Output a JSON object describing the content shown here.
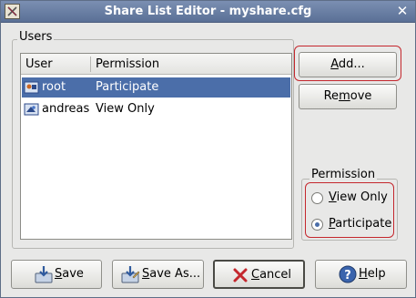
{
  "window": {
    "title": "Share List Editor - myshare.cfg",
    "close_glyph": "✕"
  },
  "users_group": {
    "label": "Users",
    "columns": [
      "User",
      "Permission"
    ],
    "rows": [
      {
        "user": "root",
        "permission": "Participate",
        "selected": true,
        "icon": "user-icon"
      },
      {
        "user": "andreas",
        "permission": "View Only",
        "selected": false,
        "icon": "user-icon"
      }
    ]
  },
  "side_buttons": {
    "add_label": "Add...",
    "add_mnemonic": "A",
    "add_rest": "dd...",
    "remove_label": "Remove",
    "remove_pre": "Re",
    "remove_mnemonic": "m",
    "remove_rest": "ove"
  },
  "permission_group": {
    "label": "Permission",
    "options": [
      {
        "label": "View Only",
        "mnemonic": "V",
        "rest": "iew Only",
        "checked": false
      },
      {
        "label": "Participate",
        "mnemonic": "P",
        "rest": "articipate",
        "checked": true
      }
    ]
  },
  "bottom_buttons": [
    {
      "label": "Save",
      "mnemonic": "S",
      "rest": "ave",
      "icon": "save-icon"
    },
    {
      "label": "Save As...",
      "mnemonic": "S",
      "rest": "ave As...",
      "icon": "save-as-icon"
    },
    {
      "label": "Cancel",
      "mnemonic": "C",
      "rest": "ancel",
      "icon": "cancel-icon"
    },
    {
      "label": "Help",
      "mnemonic": "H",
      "rest": "elp",
      "icon": "help-icon"
    }
  ],
  "colors": {
    "selection": "#4b6ea9",
    "highlight": "#c4272d",
    "titlebar": "#6a7fa4"
  }
}
